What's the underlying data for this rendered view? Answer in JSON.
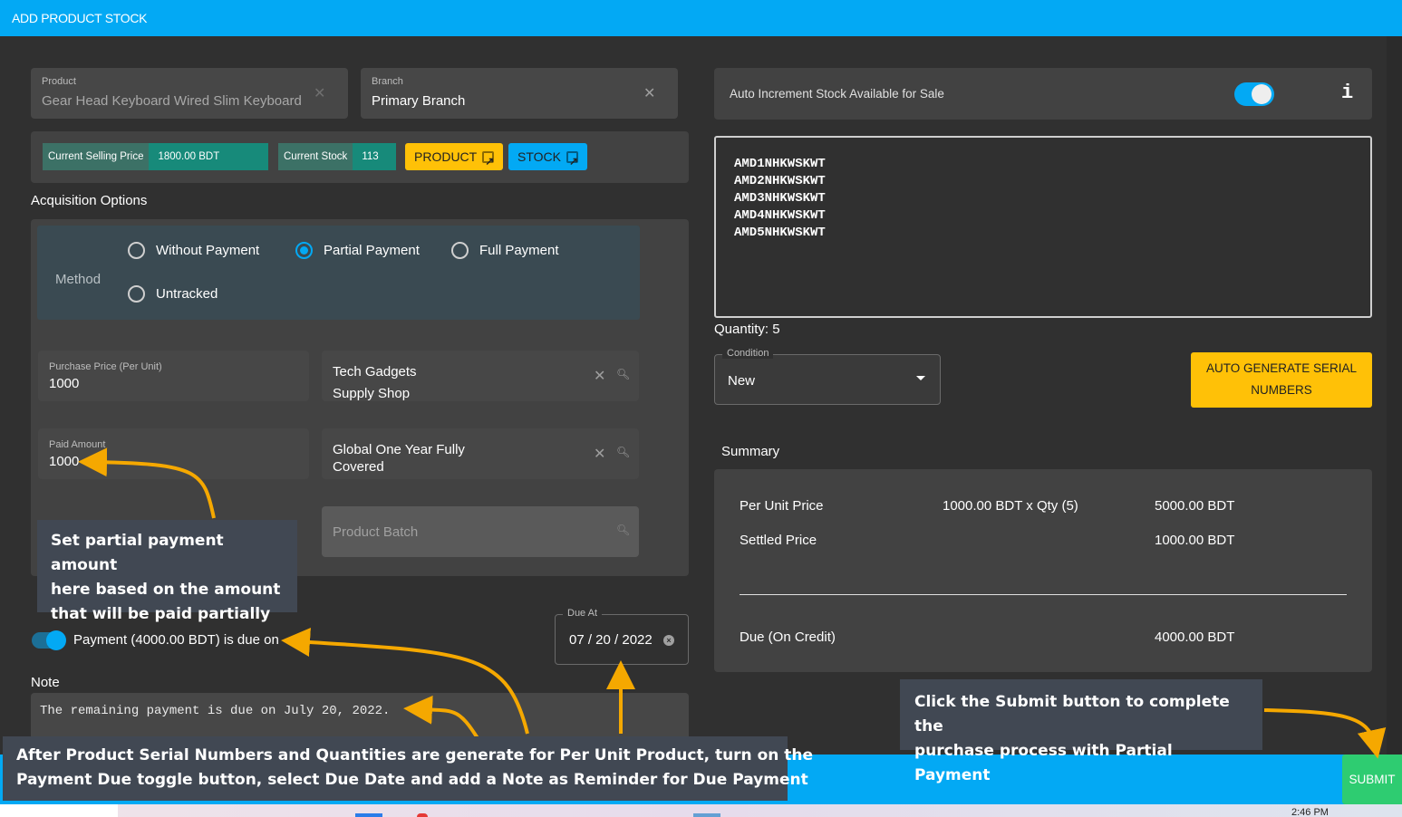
{
  "window": {
    "title": "ADD PRODUCT STOCK"
  },
  "product_field": {
    "label": "Product",
    "value": "Gear Head Keyboard Wired Slim Keyboard",
    "clear_icon": "close-icon"
  },
  "branch_field": {
    "label": "Branch",
    "value": "Primary Branch",
    "clear_icon": "close-icon"
  },
  "info_bar": {
    "selling_price_label": "Current Selling Price",
    "selling_price_value": "1800.00 BDT",
    "stock_label": "Current Stock",
    "stock_value": "113",
    "product_button": "PRODUCT",
    "stock_button": "STOCK"
  },
  "acquisition": {
    "title": "Acquisition Options",
    "method_label": "Method",
    "options": [
      {
        "label": "Without Payment",
        "selected": false
      },
      {
        "label": "Partial Payment",
        "selected": true
      },
      {
        "label": "Full Payment",
        "selected": false
      },
      {
        "label": "Untracked",
        "selected": false
      }
    ],
    "purchase_price": {
      "label": "Purchase Price (Per Unit)",
      "value": "1000"
    },
    "paid_amount": {
      "label": "Paid Amount",
      "value": "1000"
    },
    "supplier": {
      "value_line1": "Tech Gadgets",
      "value_line2": "Supply Shop"
    },
    "warranty": {
      "value_line1": "Global One Year Fully",
      "value_line2": "Covered"
    },
    "batch": {
      "placeholder": "Product Batch"
    }
  },
  "payment_due": {
    "toggle_on": true,
    "label": "Payment (4000.00 BDT) is due on",
    "due_at_label": "Due At",
    "due_at_value": "07 / 20 / 2022"
  },
  "note": {
    "label": "Note",
    "value": "The remaining payment is due on July 20, 2022."
  },
  "auto_increment": {
    "label": "Auto Increment Stock Available for Sale",
    "toggle_on": true,
    "info_icon": "i"
  },
  "serials": [
    "AMD1NHKWSKWT",
    "AMD2NHKWSKWT",
    "AMD3NHKWSKWT",
    "AMD4NHKWSKWT",
    "AMD5NHKWSKWT"
  ],
  "quantity_text": "Quantity: 5",
  "condition": {
    "label": "Condition",
    "value": "New"
  },
  "auto_generate_button": {
    "line1": "AUTO GENERATE SERIAL",
    "line2": "NUMBERS"
  },
  "summary": {
    "title": "Summary",
    "rows": [
      {
        "label": "Per Unit Price",
        "detail": "1000.00 BDT x Qty (5)",
        "amount": "5000.00 BDT"
      },
      {
        "label": "Settled Price",
        "detail": "",
        "amount": "1000.00 BDT"
      }
    ],
    "due": {
      "label": "Due (On Credit)",
      "amount": "4000.00 BDT"
    }
  },
  "footer": {
    "submit_label": "SUBMIT"
  },
  "callouts": {
    "partial": [
      "Set partial payment amount",
      "here based on the amount",
      "that will be paid partially"
    ],
    "submit": [
      "Click the Submit button to complete the",
      "purchase process with Partial Payment"
    ],
    "bottom": [
      "After Product Serial Numbers and Quantities are generate for Per Unit Product, turn on the",
      "Payment Due toggle button, select Due Date and add a Note as Reminder for Due Payment"
    ]
  },
  "taskbar": {
    "clock": "2:46 PM"
  },
  "colors": {
    "accent": "#03a9f4",
    "warning": "#ffc107",
    "success": "#2ecc71",
    "teal": "#178a7a",
    "arrow": "#f5a800"
  }
}
